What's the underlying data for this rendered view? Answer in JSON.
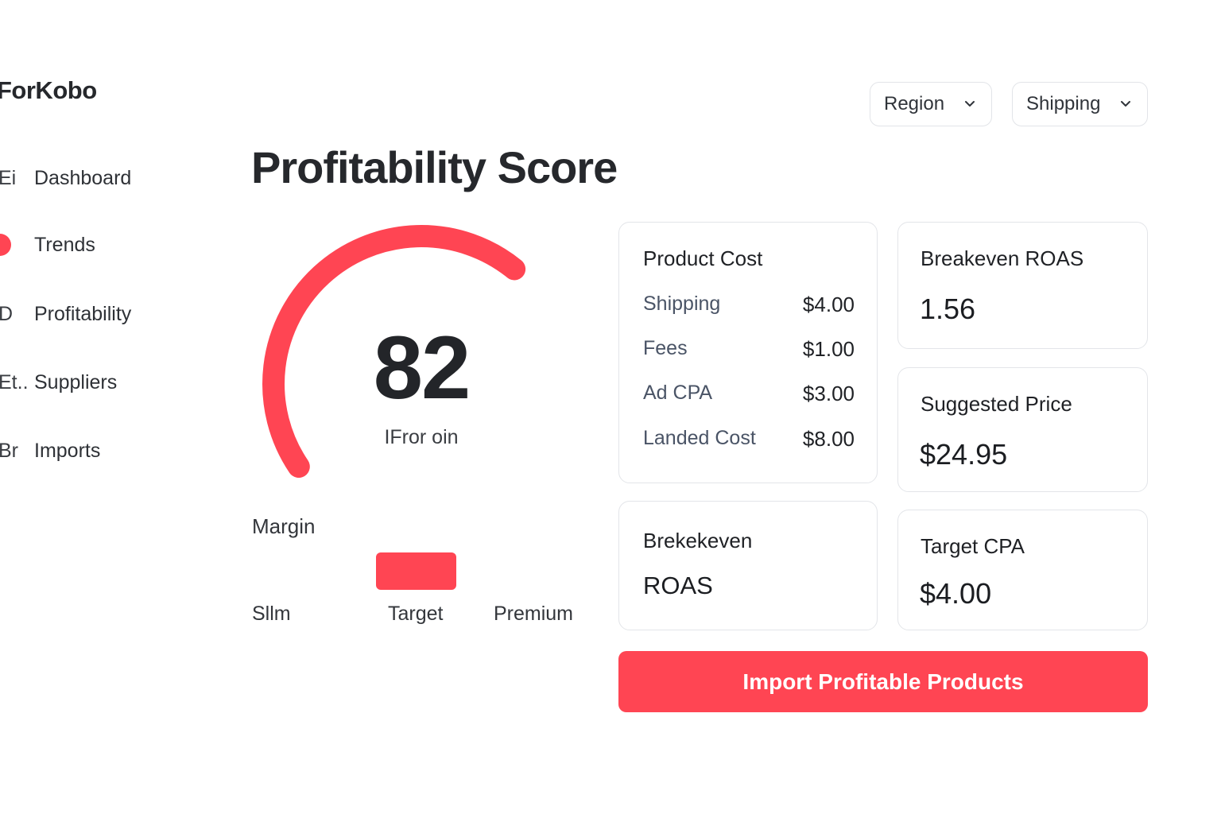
{
  "app": {
    "brand": "ForKobo"
  },
  "sidebar": {
    "items": [
      {
        "glyph": "Ei",
        "label": "Dashboard"
      },
      {
        "glyph": "",
        "label": "Trends"
      },
      {
        "glyph": "D",
        "label": "Profitability"
      },
      {
        "glyph": "Et..",
        "label": "Suppliers"
      },
      {
        "glyph": "Br",
        "label": "Imports"
      }
    ]
  },
  "filters": {
    "region_label": "Region",
    "shipping_label": "Shipping"
  },
  "page": {
    "title": "Profitability Score"
  },
  "score": {
    "value": "82",
    "caption": "IFror oin",
    "gauge_fill_fraction": 0.82,
    "color": "#ff4553"
  },
  "margin": {
    "label": "Margin",
    "ticks": [
      "Sllm",
      "Target",
      "Premium"
    ],
    "selected": "Target"
  },
  "cards": {
    "product_cost": {
      "title": "Product Cost",
      "rows": [
        {
          "label": "Shipping",
          "value": "$4.00"
        },
        {
          "label": "Fees",
          "value": "$1.00"
        },
        {
          "label": "Ad CPA",
          "value": "$3.00"
        },
        {
          "label": "Landed Cost",
          "value": "$8.00"
        }
      ]
    },
    "breakeven_roas": {
      "title": "Breakeven ROAS",
      "value": "1.56"
    },
    "suggested_price": {
      "title": "Suggested Price",
      "value": "$24.95"
    },
    "brekekeven": {
      "title": "Brekekeven",
      "value": "ROAS"
    },
    "target_cpa": {
      "title": "Target CPA",
      "value": "$4.00"
    }
  },
  "cta": {
    "label": "Import Profitable Products"
  },
  "colors": {
    "accent": "#ff4553",
    "text": "#222428",
    "border": "#e3e5e9"
  },
  "icons": {
    "dropdown": "chevron-down-icon",
    "nav_active": "dot-icon"
  }
}
